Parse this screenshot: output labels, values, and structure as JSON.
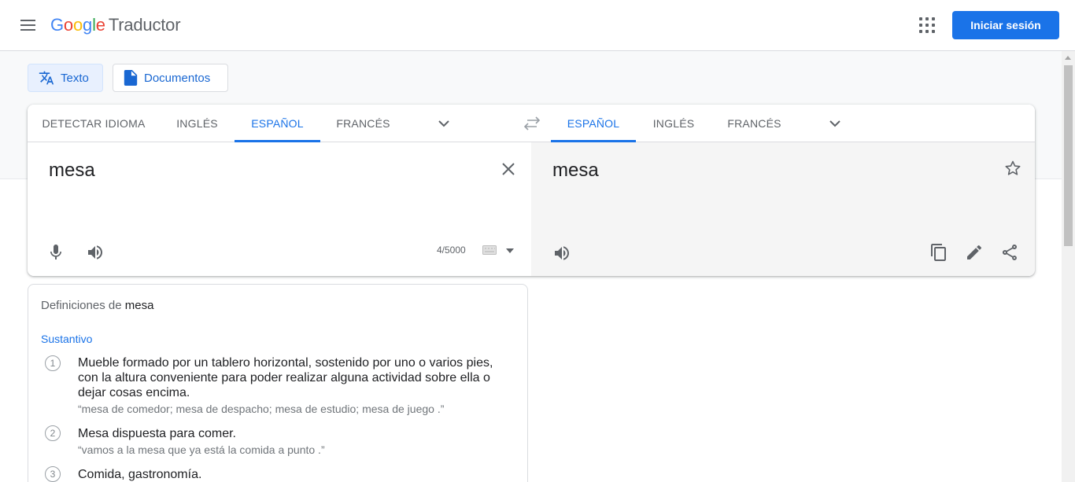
{
  "header": {
    "logo_letters": [
      "G",
      "o",
      "o",
      "g",
      "l",
      "e"
    ],
    "product": "Traductor",
    "signin_label": "Iniciar sesión"
  },
  "modes": {
    "text_label": "Texto",
    "docs_label": "Documentos"
  },
  "source_langs": [
    "DETECTAR IDIOMA",
    "INGLÉS",
    "ESPAÑOL",
    "FRANCÉS"
  ],
  "source_active": "ESPAÑOL",
  "target_langs": [
    "ESPAÑOL",
    "INGLÉS",
    "FRANCÉS"
  ],
  "target_active": "ESPAÑOL",
  "source": {
    "text": "mesa",
    "char_count": "4/5000"
  },
  "target": {
    "text": "mesa"
  },
  "definitions": {
    "title_prefix": "Definiciones de",
    "word": "mesa",
    "part_of_speech": "Sustantivo",
    "items": [
      {
        "num": "1",
        "text": "Mueble formado por un tablero horizontal, sostenido por uno o varios pies, con la altura conveniente para poder realizar alguna actividad sobre ella o dejar cosas encima.",
        "example": "“mesa de comedor; mesa de despacho; mesa de estudio; mesa de juego .”"
      },
      {
        "num": "2",
        "text": "Mesa dispuesta para comer.",
        "example": "“vamos a la mesa que ya está la comida a punto .”"
      },
      {
        "num": "3",
        "text": "Comida, gastronomía.",
        "example": ""
      }
    ]
  },
  "colors": {
    "accent": "#1a73e8",
    "icon_gray": "#5f6368"
  }
}
